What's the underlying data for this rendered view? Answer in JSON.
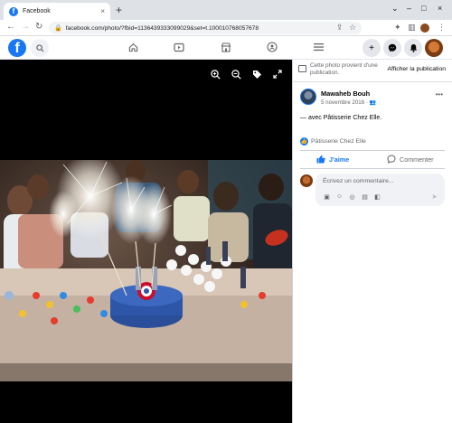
{
  "browser": {
    "tab_title": "Facebook",
    "tab_close": "×",
    "new_tab": "+",
    "url": "facebook.com/photo/?fbid=1136439333099029&set=t.100010768057678",
    "window_controls": [
      "⌄",
      "–",
      "□",
      "×"
    ]
  },
  "fb": {
    "logo_letter": "f",
    "nav_icons": [
      "home-icon",
      "watch-icon",
      "marketplace-icon",
      "groups-icon",
      "menu-icon"
    ],
    "right_icons": [
      "create-icon",
      "messenger-icon",
      "notifications-icon",
      "account-icon"
    ]
  },
  "viewer": {
    "tools": [
      "zoom-in-icon",
      "zoom-out-icon",
      "tag-icon",
      "fullscreen-icon"
    ]
  },
  "panel": {
    "album_text": "Cette photo provient d'une publication.",
    "album_link": "Afficher la publication",
    "author": "Mawaheb Bouh",
    "date": "5 novembre 2016 ·",
    "caption_prefix": "— avec",
    "caption_page": "Pâtisserie Chez Elle",
    "caption_suffix": ".",
    "reaction_name": "Pâtisserie Chez Elle",
    "like_label": "J'aime",
    "comment_label": "Commenter",
    "comment_placeholder": "Écrivez un commentaire..."
  },
  "colors": {
    "facebook_blue": "#1877f2",
    "viewer_bg": "#000000",
    "comment_bg": "#f0f2f5"
  }
}
